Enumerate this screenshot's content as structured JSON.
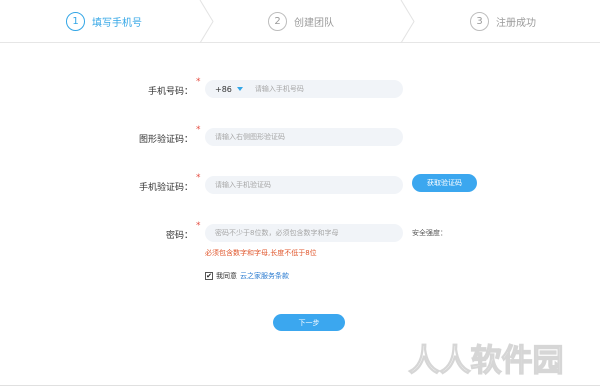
{
  "steps": [
    {
      "num": "1",
      "label": "填写手机号",
      "active": true
    },
    {
      "num": "2",
      "label": "创建团队",
      "active": false
    },
    {
      "num": "3",
      "label": "注册成功",
      "active": false
    }
  ],
  "form": {
    "phone": {
      "label": "手机号码：",
      "country_code": "+86",
      "placeholder": "请输入手机号码"
    },
    "captcha": {
      "label": "图形验证码：",
      "placeholder": "请输入右侧图形验证码"
    },
    "sms": {
      "label": "手机验证码：",
      "placeholder": "请输入手机验证码",
      "button": "获取验证码"
    },
    "password": {
      "label": "密码：",
      "placeholder": "密码不少于8位数，必须包含数字和字母",
      "strength_label": "安全强度：",
      "error": "必须包含数字和字母,长度不低于8位"
    },
    "required_mark": "*"
  },
  "agreement": {
    "checked": true,
    "text": "我同意",
    "link": "云之家服务条款"
  },
  "next_button": "下一步",
  "watermark_text": "人人软件园",
  "colors": {
    "accent": "#3ba7ef",
    "error": "#e0562b",
    "link": "#2a7bd0",
    "field_bg": "#f1f4f8"
  }
}
